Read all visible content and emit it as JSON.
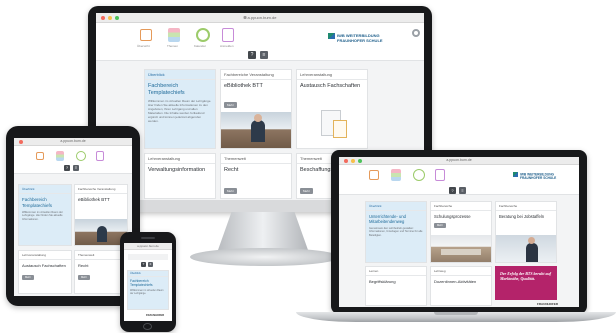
{
  "browser": {
    "url_desktop": "a.ppuon.bum.de",
    "url_tablet": "a.ppuon.bum.de",
    "url_laptop": "a.ppuon.bum.de",
    "url_phone": "a.ppuon.bum.de"
  },
  "header": {
    "logo_line1": "IWB WEITERBILDUNG",
    "logo_line2": "FRAUNHOFER SCHULE",
    "nav": [
      "Übersicht",
      "Themen",
      "Kalender",
      "Anmelden"
    ],
    "sub_buttons": [
      "?",
      "≡"
    ],
    "sub_labels": [
      "Hilfe",
      "Menü"
    ]
  },
  "desktop": {
    "tiles": [
      {
        "category": "Überblick",
        "title": "Fachbereich Templatechiefs",
        "body": "Willkommen im virtuellen Raum der Lehrgänge. Hier finden Sie aktuelle Informationen zu den Angeboten, Ihren Lehrgang und allen Materialien. Die Inhalte werden fortlaufend ergänzt und können jederzeit abgerufen werden."
      },
      {
        "category": "Fachbereiche Veranstaltung",
        "title": "eBibliothek BTT",
        "button": "Mehr"
      },
      {
        "category": "Lehrveranstaltung",
        "title": "Austausch Fachschaften"
      },
      {
        "category": "Lehrveranstaltung",
        "title": "Verwaltungsinformation"
      },
      {
        "category": "Themenwelt",
        "title": "Recht",
        "button": "Mehr"
      },
      {
        "category": "Themenwelt",
        "title": "Beschaffungswesen",
        "button": "Mehr"
      }
    ],
    "footer": "FRAUNHOFER"
  },
  "tablet": {
    "tiles": [
      {
        "category": "Überblick",
        "title": "Fachbereich Templatechiefs",
        "body": "Willkommen im virtuellen Raum der Lehrgänge. Hier finden Sie aktuelle Informationen."
      },
      {
        "category": "Fachbereiche Veranstaltung",
        "title": "eBibliothek BTT"
      },
      {
        "category": "Lehrveranstaltung",
        "title": "Austausch Fachschaften",
        "button": "Mehr"
      },
      {
        "category": "Themenwelt",
        "title": "Recht",
        "button": "Mehr"
      }
    ]
  },
  "phone": {
    "tile": {
      "category": "Überblick",
      "title": "Fachbereich Templatechiefs",
      "body": "Willkommen im virtuellen Raum der Lehrgänge."
    },
    "footer": "FRAUNHOFER"
  },
  "laptop": {
    "tiles": [
      {
        "category": "Überblick",
        "title": "Unterrichtende- und Mitarbeitendenweg",
        "body": "Gemeinsam den Lehrbetrieb gestalten: Informationen, Unterlagen und Termine für alle Beteiligten.",
        "button": "Mehr"
      },
      {
        "category": "Fachbereiche",
        "title": "Schulungsprozesse",
        "button": "Mehr"
      },
      {
        "category": "Fachbereiche",
        "title": "Beratung bei Jobstaffeln"
      },
      {
        "category": "Lernen",
        "title": "Begriffsklärung"
      },
      {
        "category": "Lehrweg",
        "title": "Dozentinnen-Aktivitäten"
      }
    ],
    "promo": "Der Erfolg der BTS beruht auf Marktnähe, Qualität.",
    "footer": "FRAUNHOFER"
  },
  "colors": {
    "accent_blue": "#2a6fa5",
    "promo_magenta": "#b4236a",
    "bezel": "#17181a"
  }
}
